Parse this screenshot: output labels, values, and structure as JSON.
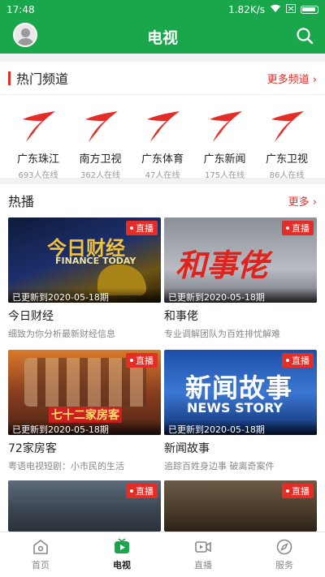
{
  "status_bar": {
    "time": "17:48",
    "speed": "1.82K/s"
  },
  "header": {
    "title": "电视"
  },
  "hot_channels": {
    "title": "热门频道",
    "more": "更多频道 ›",
    "channels": [
      {
        "name": "广东珠江",
        "count": "693人在线"
      },
      {
        "name": "南方卫视",
        "count": "362人在线"
      },
      {
        "name": "广东体育",
        "count": "47人在线"
      },
      {
        "name": "广东新闻",
        "count": "175人在线"
      },
      {
        "name": "广东卫视",
        "count": "86人在线"
      }
    ]
  },
  "hot_play": {
    "title": "热播",
    "more": "更多 ›",
    "live_label": "直播",
    "cards": [
      {
        "title": "今日财经",
        "subtitle": "细致为你分析最新财经信息",
        "updated": "已更新到2020-05-18期",
        "thumb_text": "今日财经",
        "thumb_sub": "FINANCE TODAY"
      },
      {
        "title": "和事佬",
        "subtitle": "专业调解团队为百姓排忧解难",
        "updated": "已更新到2020-05-18期",
        "thumb_text": "和事佬"
      },
      {
        "title": "72家房客",
        "subtitle": "粤语电视短剧：小市民的生活",
        "updated": "已更新到2020-05-18期",
        "thumb_text": "七十二家房客"
      },
      {
        "title": "新闻故事",
        "subtitle": "追踪百姓身边事 破离奇案件",
        "updated": "已更新到2020-05-18期",
        "thumb_text": "新闻故事",
        "thumb_sub": "NEWS STORY"
      },
      {
        "title": "",
        "subtitle": "",
        "updated": ""
      },
      {
        "title": "",
        "subtitle": "",
        "updated": ""
      }
    ]
  },
  "bottom_nav": [
    {
      "label": "首页",
      "icon": "home-icon"
    },
    {
      "label": "电视",
      "icon": "tv-play-icon"
    },
    {
      "label": "直播",
      "icon": "video-camera-icon"
    },
    {
      "label": "服务",
      "icon": "compass-icon"
    }
  ],
  "colors": {
    "brand_green": "#1aa64a",
    "accent_red": "#e52d27"
  }
}
